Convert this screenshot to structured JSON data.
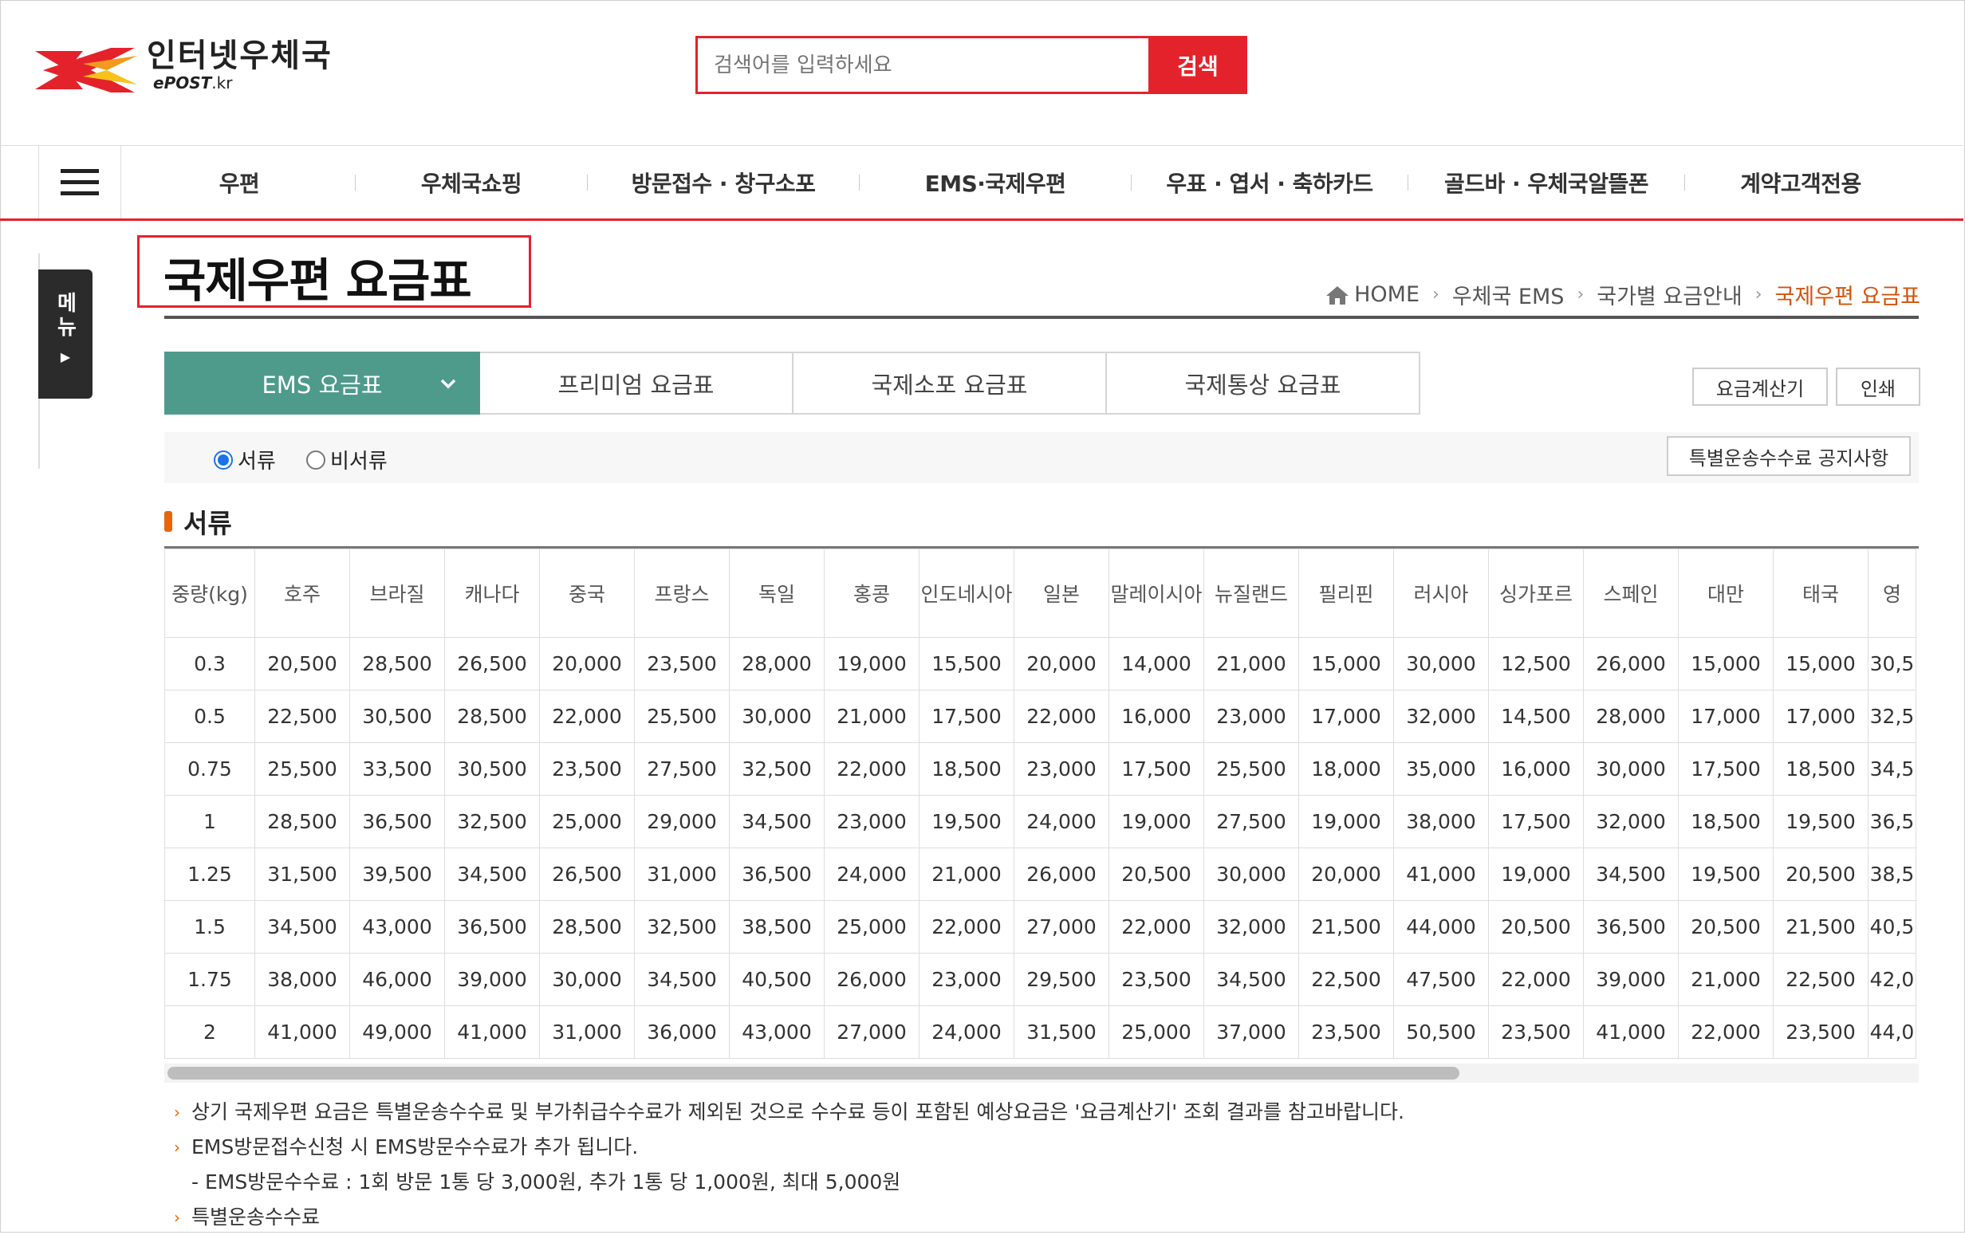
{
  "header": {
    "logo_kr": "인터넷우체국",
    "logo_en_prefix": "ePOST",
    "logo_en_suffix": ".kr",
    "search_placeholder": "검색어를 입력하세요",
    "search_button": "검색"
  },
  "nav": {
    "items": [
      "우편",
      "우체국쇼핑",
      "방문접수 · 창구소포",
      "EMS·국제우편",
      "우표 · 엽서 · 축하카드",
      "골드바 · 우체국알뜰폰",
      "계약고객전용"
    ]
  },
  "side_menu": {
    "label": "메뉴"
  },
  "page": {
    "title": "국제우편 요금표",
    "breadcrumb": [
      "HOME",
      "우체국 EMS",
      "국가별 요금안내",
      "국제우편 요금표"
    ]
  },
  "tabs": [
    "EMS 요금표",
    "프리미엄 요금표",
    "국제소포 요금표",
    "국제통상 요금표"
  ],
  "buttons": {
    "calculator": "요금계산기",
    "print": "인쇄",
    "notice": "특별운송수수료 공지사항"
  },
  "radio": {
    "options": [
      "서류",
      "비서류"
    ],
    "selected": "서류"
  },
  "section_title": "서류",
  "table": {
    "headers": [
      "중량(kg)",
      "호주",
      "브라질",
      "캐나다",
      "중국",
      "프랑스",
      "독일",
      "홍콩",
      "인도네시아",
      "일본",
      "말레이시아",
      "뉴질랜드",
      "필리핀",
      "러시아",
      "싱가포르",
      "스페인",
      "대만",
      "태국",
      "영"
    ],
    "rows": [
      [
        "0.3",
        "20,500",
        "28,500",
        "26,500",
        "20,000",
        "23,500",
        "28,000",
        "19,000",
        "15,500",
        "20,000",
        "14,000",
        "21,000",
        "15,000",
        "30,000",
        "12,500",
        "26,000",
        "15,000",
        "15,000",
        "30,5"
      ],
      [
        "0.5",
        "22,500",
        "30,500",
        "28,500",
        "22,000",
        "25,500",
        "30,000",
        "21,000",
        "17,500",
        "22,000",
        "16,000",
        "23,000",
        "17,000",
        "32,000",
        "14,500",
        "28,000",
        "17,000",
        "17,000",
        "32,5"
      ],
      [
        "0.75",
        "25,500",
        "33,500",
        "30,500",
        "23,500",
        "27,500",
        "32,500",
        "22,000",
        "18,500",
        "23,000",
        "17,500",
        "25,500",
        "18,000",
        "35,000",
        "16,000",
        "30,000",
        "17,500",
        "18,500",
        "34,5"
      ],
      [
        "1",
        "28,500",
        "36,500",
        "32,500",
        "25,000",
        "29,000",
        "34,500",
        "23,000",
        "19,500",
        "24,000",
        "19,000",
        "27,500",
        "19,000",
        "38,000",
        "17,500",
        "32,000",
        "18,500",
        "19,500",
        "36,5"
      ],
      [
        "1.25",
        "31,500",
        "39,500",
        "34,500",
        "26,500",
        "31,000",
        "36,500",
        "24,000",
        "21,000",
        "26,000",
        "20,500",
        "30,000",
        "20,000",
        "41,000",
        "19,000",
        "34,500",
        "19,500",
        "20,500",
        "38,5"
      ],
      [
        "1.5",
        "34,500",
        "43,000",
        "36,500",
        "28,500",
        "32,500",
        "38,500",
        "25,000",
        "22,000",
        "27,000",
        "22,000",
        "32,000",
        "21,500",
        "44,000",
        "20,500",
        "36,500",
        "20,500",
        "21,500",
        "40,5"
      ],
      [
        "1.75",
        "38,000",
        "46,000",
        "39,000",
        "30,000",
        "34,500",
        "40,500",
        "26,000",
        "23,000",
        "29,500",
        "23,500",
        "34,500",
        "22,500",
        "47,500",
        "22,000",
        "39,000",
        "21,000",
        "22,500",
        "42,0"
      ],
      [
        "2",
        "41,000",
        "49,000",
        "41,000",
        "31,000",
        "36,000",
        "43,000",
        "27,000",
        "24,000",
        "31,500",
        "25,000",
        "37,000",
        "23,500",
        "50,500",
        "23,500",
        "41,000",
        "22,000",
        "23,500",
        "44,0"
      ]
    ]
  },
  "notes": [
    "상기 국제우편 요금은 특별운송수수료 및 부가취급수수료가 제외된 것으로 수수료 등이 포함된 예상요금은 '요금계산기' 조회 결과를 참고바랍니다.",
    "EMS방문접수신청 시 EMS방문수수료가 추가 됩니다.",
    "- EMS방문수수료 : 1회 방문 1통 당 3,000원, 추가 1통 당 1,000원, 최대 5,000원",
    "특별운송수수료"
  ],
  "colors": {
    "brand_red": "#e4222b",
    "tab_active": "#4e9b8c",
    "accent_orange": "#e8650a"
  },
  "icons": {
    "logo": "epost-logo-icon",
    "menu": "hamburger-icon",
    "home": "home-icon",
    "tab_dropdown": "chevron-down-icon"
  }
}
